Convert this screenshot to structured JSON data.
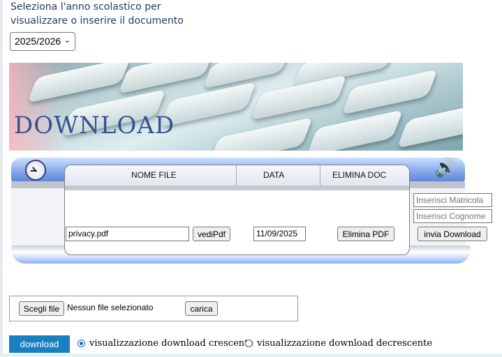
{
  "intro": {
    "line1": "Seleziona l'anno scolastico per",
    "line2": "visualizzare o inserire il documento"
  },
  "year_select": {
    "value": "2025/2026"
  },
  "banner": {
    "title": "DOWNLOAD"
  },
  "table": {
    "headers": [
      "NOME FILE",
      "DATA",
      "ELIMINA DOC"
    ],
    "rows": [
      {
        "file": "privacy.pdf",
        "view_label": "vediPdf",
        "date": "11/09/2025",
        "delete_label": "Elimina PDF"
      }
    ]
  },
  "side_form": {
    "matricola_placeholder": "Inserisci Matricola",
    "cognome_placeholder": "Inserisci Cognome",
    "send_label": "invia Download"
  },
  "upload": {
    "choose_label": "Scegli file",
    "no_file_text": "Nessun file selezionato",
    "upload_label": "carica"
  },
  "download": {
    "button_label": "download",
    "sort_options": [
      {
        "label": "visualizzazione download crescente",
        "checked": true
      },
      {
        "label": "visualizzazione download decrescente",
        "checked": false
      }
    ]
  },
  "colors": {
    "accent": "#1a7fc1",
    "heading": "#1f3b66",
    "banner_title": "#34528f"
  }
}
